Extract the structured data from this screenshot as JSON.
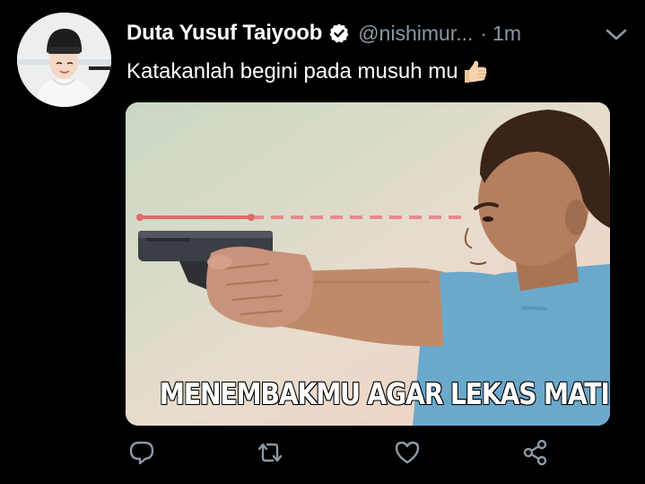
{
  "tweet": {
    "display_name": "Duta Yusuf Taiyoob",
    "handle": "@nishimur...",
    "separator": "·",
    "time": "1m",
    "text": "Katakanlah begini pada musuh mu",
    "text_emoji": "thumbs-up",
    "verified": true
  },
  "media": {
    "caption": "MENEMBAKMU AGAR LEKAS MATI"
  },
  "actions": {
    "reply_icon": "reply-icon",
    "retweet_icon": "retweet-icon",
    "like_icon": "heart-icon",
    "share_icon": "share-icon"
  },
  "colors": {
    "background": "#000000",
    "text": "#ffffff",
    "muted": "#8b98a5",
    "verified_badge": "#ffffff",
    "icon": "#8b98a5"
  }
}
